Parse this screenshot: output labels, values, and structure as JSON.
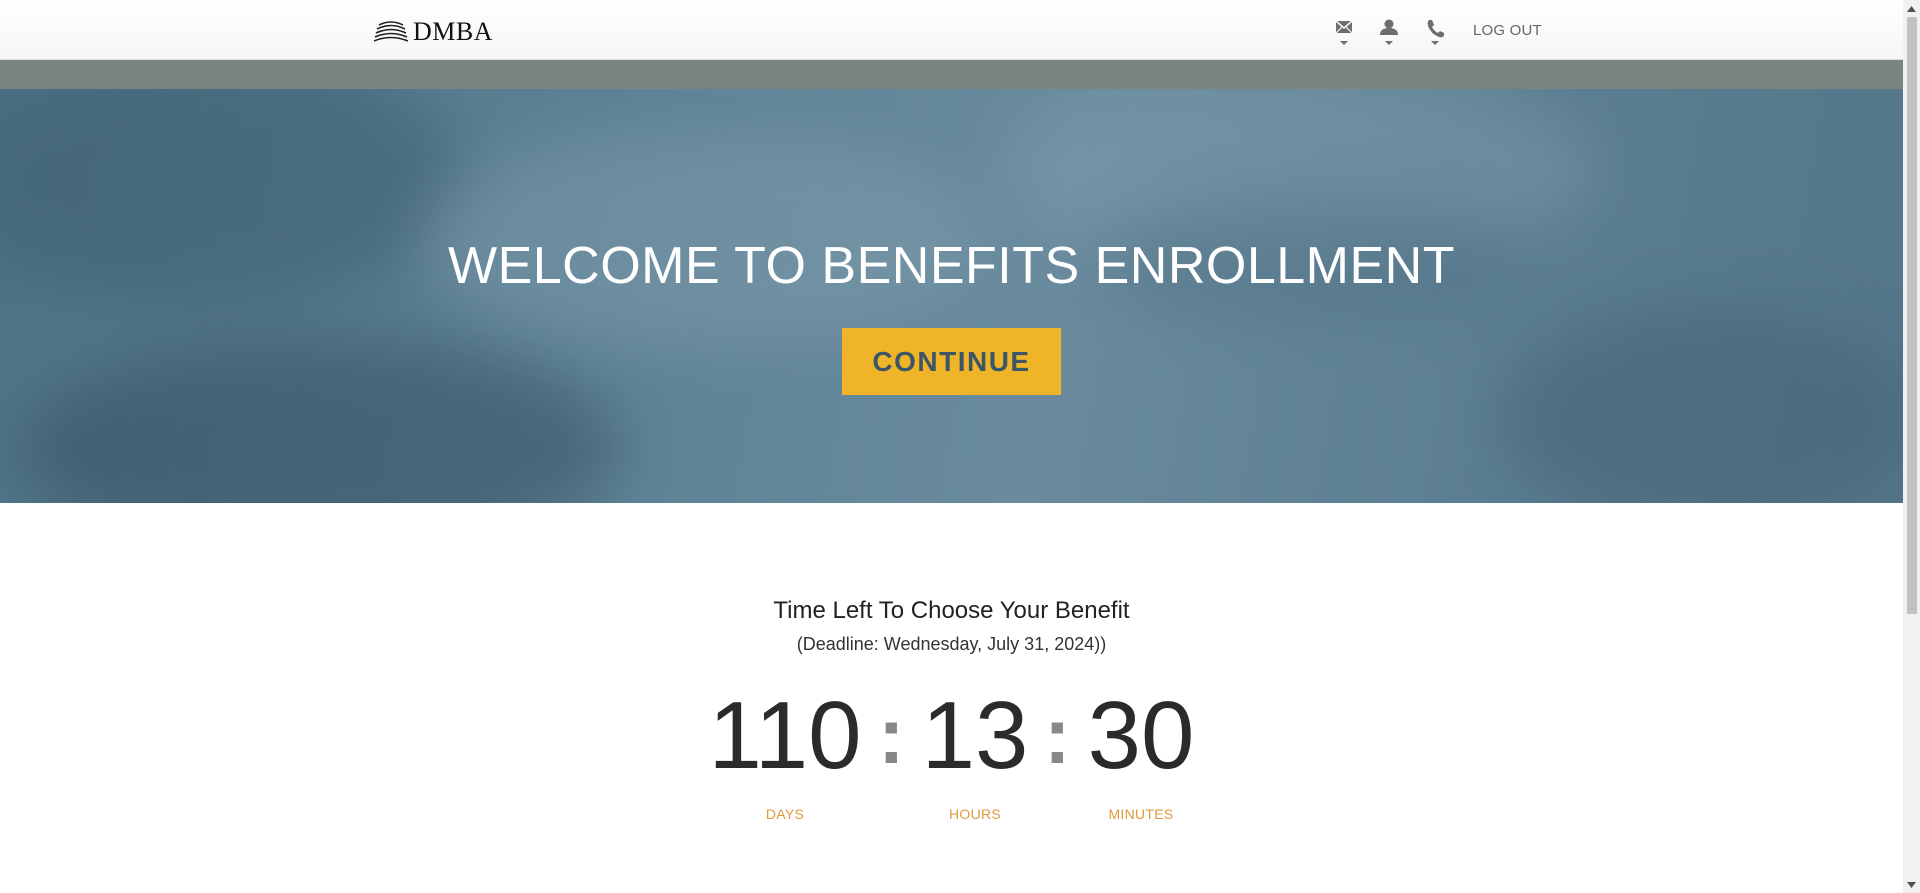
{
  "header": {
    "brand": "DMBA",
    "icons": [
      "mail-icon",
      "user-icon",
      "phone-icon"
    ],
    "logout_label": "LOG OUT"
  },
  "hero": {
    "title": "WELCOME TO BENEFITS ENROLLMENT",
    "button_label": "CONTINUE"
  },
  "countdown": {
    "title": "Time Left To Choose Your Benefit",
    "deadline": "(Deadline: Wednesday, July 31, 2024))",
    "days": "110",
    "hours": "13",
    "minutes": "30",
    "separator": ":",
    "days_label": "DAYS",
    "hours_label": "HOURS",
    "minutes_label": "MINUTES"
  },
  "colors": {
    "accent": "#f0b429",
    "label_orange": "#e09a3d",
    "hero_overlay": "#5f8296",
    "button_text": "#3b5667"
  }
}
